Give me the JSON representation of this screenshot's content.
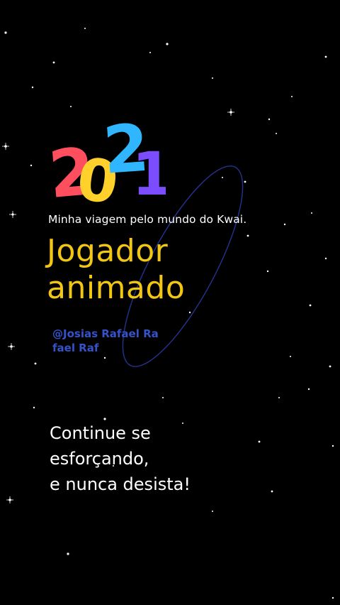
{
  "logo": {
    "year": "2021"
  },
  "card": {
    "subtitle": "Minha viagem pelo mundo do Kwai.",
    "title_line1": "Jogador",
    "title_line2": "animado",
    "handle_line1": "@Josias Rafael Ra",
    "handle_line2": "fael Raf"
  },
  "message": {
    "line1": "Continue se",
    "line2": "esforçando,",
    "line3": "e nunca desista!"
  },
  "colors": {
    "background": "#000000",
    "title": "#f3c613",
    "handle": "#3552c9",
    "digit_2_first": "#ff4f5e",
    "digit_0": "#ffd12a",
    "digit_2_second": "#2fb6ff",
    "digit_1": "#7b4dff"
  }
}
